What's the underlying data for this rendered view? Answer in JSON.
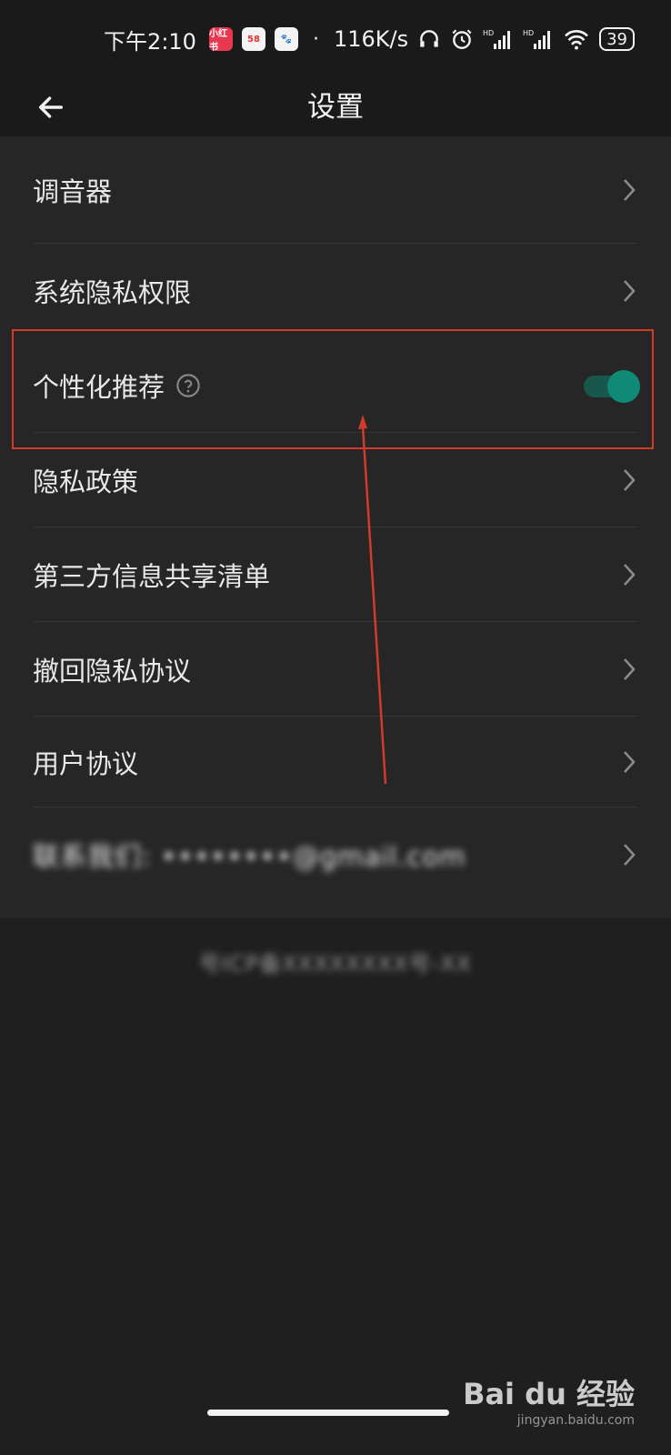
{
  "status_bar": {
    "time": "下午2:10",
    "app_badges": [
      "小红书",
      "58",
      "百度"
    ],
    "network_speed": "116K/s",
    "signal_1_label": "HD",
    "signal_2_label": "HD",
    "battery": "39"
  },
  "app_bar": {
    "title": "设置"
  },
  "settings": {
    "items": [
      {
        "label": "调音器",
        "control": "chevron"
      },
      {
        "label": "系统隐私权限",
        "control": "chevron"
      },
      {
        "label": "个性化推荐",
        "control": "toggle",
        "toggle_on": true,
        "has_help": true
      },
      {
        "label": "隐私政策",
        "control": "chevron"
      },
      {
        "label": "第三方信息共享清单",
        "control": "chevron"
      },
      {
        "label": "撤回隐私协议",
        "control": "chevron"
      },
      {
        "label": "用户协议",
        "control": "chevron"
      },
      {
        "label": "联系我们: ••••••••@gmail.com",
        "control": "chevron",
        "blurred": true
      }
    ]
  },
  "footer": {
    "text": "号ICP备XXXXXXXX号-XX"
  },
  "watermark": {
    "brand": "Bai du 经验",
    "sub": "jingyan.baidu.com"
  },
  "colors": {
    "background": "#1f1f1f",
    "card": "#262626",
    "toggle_on": "#0f8a76",
    "highlight": "#d23a2c"
  }
}
